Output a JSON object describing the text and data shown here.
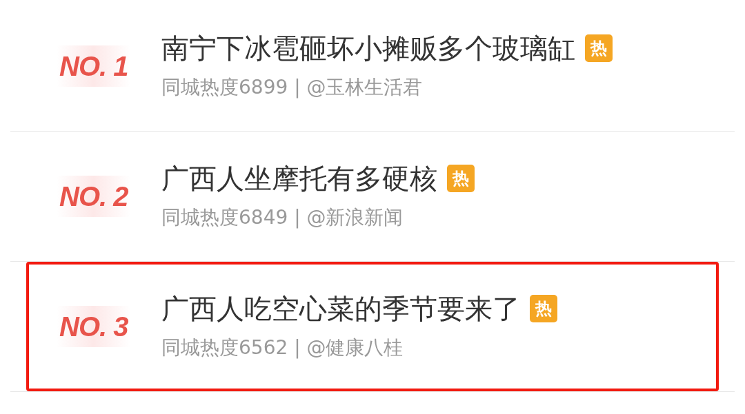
{
  "items": [
    {
      "rank": "NO. 1",
      "title": "南宁下冰雹砸坏小摊贩多个玻璃缸",
      "badge": "热",
      "meta": "同城热度6899 | @玉林生活君",
      "highlighted": false
    },
    {
      "rank": "NO. 2",
      "title": "广西人坐摩托有多硬核",
      "badge": "热",
      "meta": "同城热度6849 | @新浪新闻",
      "highlighted": false
    },
    {
      "rank": "NO. 3",
      "title": "广西人吃空心菜的季节要来了",
      "badge": "热",
      "meta": "同城热度6562 | @健康八桂",
      "highlighted": true
    }
  ]
}
